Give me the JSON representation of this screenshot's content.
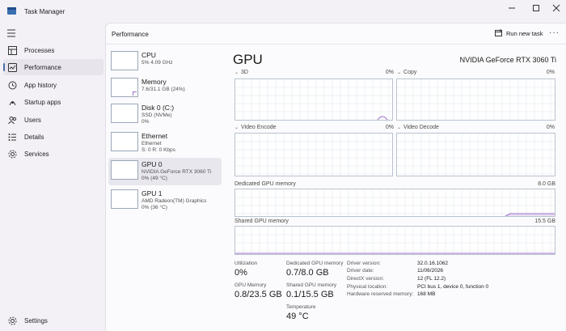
{
  "window": {
    "title": "Task Manager"
  },
  "sidebar": {
    "items": [
      {
        "label": "Processes"
      },
      {
        "label": "Performance"
      },
      {
        "label": "App history"
      },
      {
        "label": "Startup apps"
      },
      {
        "label": "Users"
      },
      {
        "label": "Details"
      },
      {
        "label": "Services"
      }
    ],
    "settings": "Settings"
  },
  "header": {
    "title": "Performance",
    "run_task": "Run new task"
  },
  "devices": [
    {
      "name": "CPU",
      "lines": [
        "5% 4.09 GHz"
      ]
    },
    {
      "name": "Memory",
      "lines": [
        "7.6/31.1 GB (24%)"
      ]
    },
    {
      "name": "Disk 0 (C:)",
      "lines": [
        "SSD (NVMe)",
        "0%"
      ]
    },
    {
      "name": "Ethernet",
      "lines": [
        "Ethernet",
        "S: 0 R: 0 Kbps"
      ]
    },
    {
      "name": "GPU 0",
      "lines": [
        "NVIDIA GeForce RTX 3060 Ti",
        "0% (49 °C)"
      ]
    },
    {
      "name": "GPU 1",
      "lines": [
        "AMD Radeon(TM) Graphics",
        "0% (36 °C)"
      ]
    }
  ],
  "gpu": {
    "title": "GPU",
    "model": "NVIDIA GeForce RTX 3060 Ti",
    "engines": [
      {
        "label": "3D",
        "pct": "0%"
      },
      {
        "label": "Copy",
        "pct": "0%"
      },
      {
        "label": "Video Encode",
        "pct": "0%"
      },
      {
        "label": "Video Decode",
        "pct": "0%"
      }
    ],
    "dedicated": {
      "label": "Dedicated GPU memory",
      "max": "8.0 GB"
    },
    "shared": {
      "label": "Shared GPU memory",
      "max": "15.5 GB"
    },
    "stats": {
      "utilization_label": "Utilization",
      "utilization": "0%",
      "dedicated_label": "Dedicated GPU memory",
      "dedicated": "0.7/8.0 GB",
      "gpu_memory_label": "GPU Memory",
      "gpu_memory": "0.8/23.5 GB",
      "shared_label": "Shared GPU memory",
      "shared": "0.1/15.5 GB",
      "temp_label": "Temperature",
      "temp": "49 °C"
    },
    "info": [
      {
        "k": "Driver version:",
        "v": "32.0.16.1062"
      },
      {
        "k": "Driver date:",
        "v": "11/06/2026"
      },
      {
        "k": "DirectX version:",
        "v": "12 (FL 12.2)"
      },
      {
        "k": "Physical location:",
        "v": "PCI bus 1, device 0, function 0"
      },
      {
        "k": "Hardware reserved memory:",
        "v": "168 MB"
      }
    ]
  },
  "colors": {
    "accent": "#4a6fa5",
    "graph_line": "#9b6fc8",
    "graph_border": "#b9c3d0"
  }
}
